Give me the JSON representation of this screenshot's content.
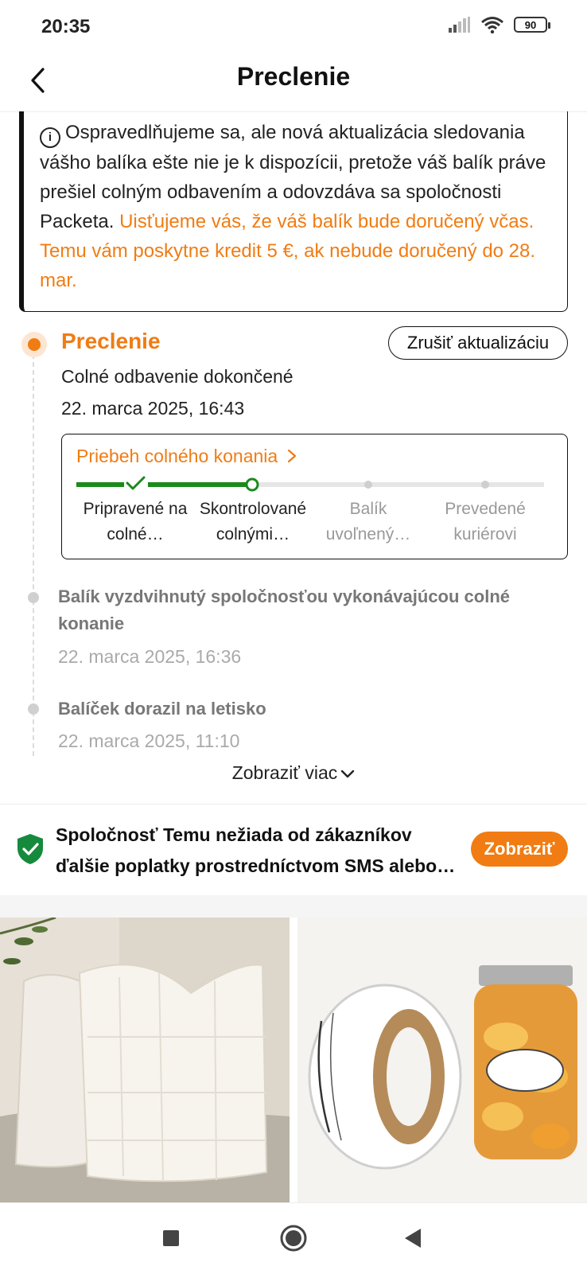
{
  "status_bar": {
    "time": "20:35",
    "battery": "90",
    "icons": [
      "signal-icon",
      "wifi-icon",
      "battery-icon"
    ]
  },
  "header": {
    "title": "Preclenie",
    "back_icon": "chevron-left-icon"
  },
  "notice": {
    "text": "Ospravedlňujeme sa, ale nová aktualizácia sledovania vášho balíka ešte nie je k dispozícii, pretože váš balík práve prešiel colným odbavením a odovzdáva sa spoločnosti Packeta.",
    "highlight": "Uisťujeme vás, že váš balík bude doručený včas. Temu vám poskytne kredit 5 €, ak nebude doručený do 28. mar.",
    "highlight_color": "#f07c13"
  },
  "current_stage": {
    "title": "Preclenie",
    "cancel_button": "Zrušiť aktualizáciu",
    "description": "Colné odbavenie dokončené",
    "time": "22. marca 2025, 16:43"
  },
  "customs_progress": {
    "link": "Priebeh colného konania",
    "completed_steps": 2,
    "steps": [
      {
        "label": "Pripravené na colné…",
        "state": "done"
      },
      {
        "label": "Skontrolované colnými…",
        "state": "current"
      },
      {
        "label": "Balík uvoľnený…",
        "state": "pending"
      },
      {
        "label": "Prevedené kuriérovi",
        "state": "pending"
      }
    ],
    "progress_color": "#1b8a1b"
  },
  "events": [
    {
      "title": "Balík vyzdvihnutý spoločnosťou vykonávajúcou colné konanie",
      "time": "22. marca 2025, 16:36"
    },
    {
      "title": "Balíček dorazil na letisko",
      "time": "22. marca 2025, 11:10"
    }
  ],
  "show_more": "Zobraziť viac",
  "safety_banner": {
    "text": "Spoločnosť Temu nežiada od zákazníkov ďalšie poplatky prostredníctvom SMS alebo e-mailu.",
    "button": "Zobraziť",
    "icon": "shield-check-icon"
  },
  "products": [
    {
      "name": "throw-pillows-image"
    },
    {
      "name": "jar-labels-image"
    }
  ],
  "navbar": {
    "buttons": [
      "recent-apps-button",
      "home-button",
      "back-button"
    ]
  },
  "colors": {
    "accent": "#f07c13",
    "success": "#1b8a1b"
  }
}
